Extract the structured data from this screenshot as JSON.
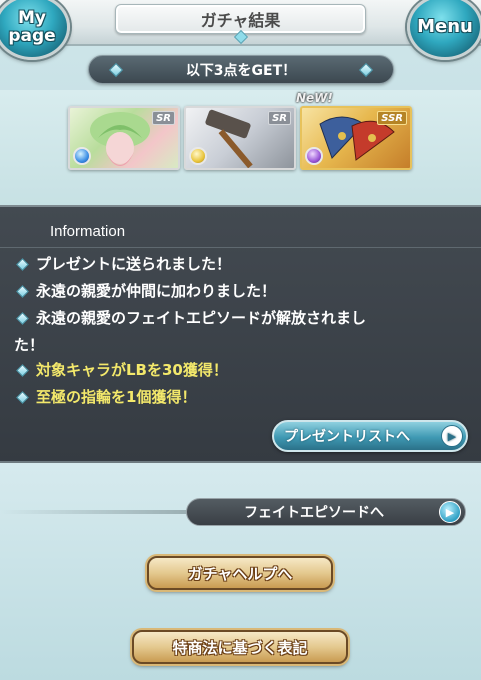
{
  "header": {
    "title": "ガチャ結果",
    "mypage_label": "My page",
    "menu_label": "Menu"
  },
  "banner": {
    "text": "以下3点をGET！"
  },
  "cards": {
    "new_label": "NeW!",
    "items": [
      {
        "rarity": "SR",
        "element": "wind",
        "icon": "character-portrait"
      },
      {
        "rarity": "SR",
        "element": "light",
        "icon": "hammer-weapon"
      },
      {
        "rarity": "SSR",
        "element": "dark",
        "icon": "fan-weapon"
      }
    ]
  },
  "info": {
    "heading": "Information",
    "messages": [
      {
        "text": "プレゼントに送られました！",
        "color": "#ffffff"
      },
      {
        "text": "永遠の親愛が仲間に加わりました！",
        "color": "#ffffff"
      },
      {
        "text": "永遠の親愛のフェイトエピソードが解放されまし",
        "color": "#ffffff"
      },
      {
        "text": "た！",
        "color": "#ffffff"
      },
      {
        "text": "対象キャラがLBを30獲得！",
        "color": "#f3e86b"
      },
      {
        "text": "至極の指輪を1個獲得！",
        "color": "#f3e86b"
      }
    ],
    "present_button_label": "プレゼントリストへ"
  },
  "lower": {
    "fate_button_label": "フェイトエピソードへ",
    "help_button_label": "ガチャヘルプへ",
    "law_button_label": "特商法に基づく表記"
  },
  "colors": {
    "panel_bg": "#3c434a",
    "accent_blue": "#3f99b3",
    "highlight_yellow": "#f3e86b",
    "gold": "#e4c98f"
  }
}
